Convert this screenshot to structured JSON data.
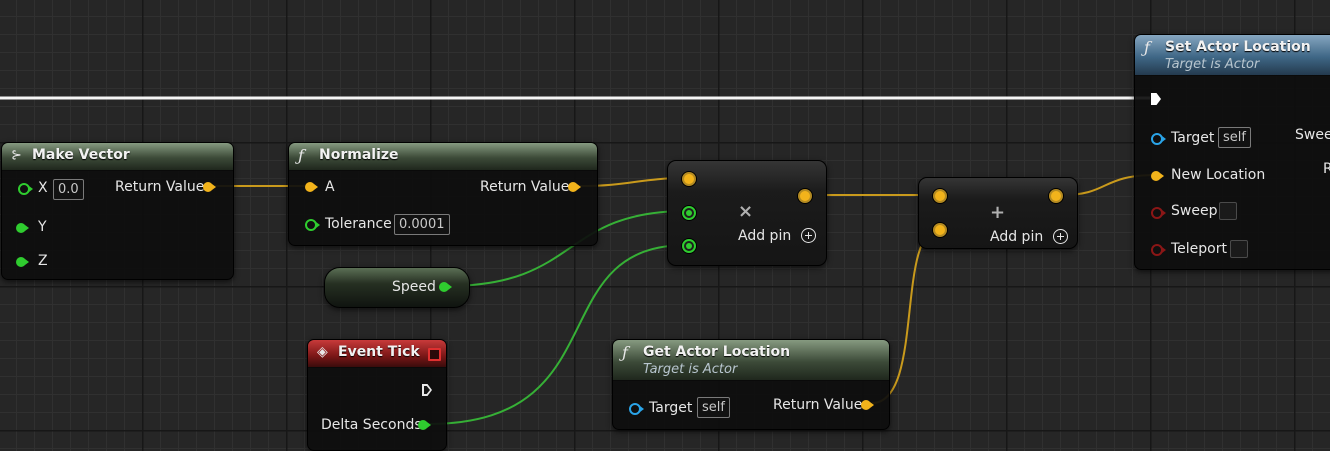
{
  "colors": {
    "float_pin": "#f2b31b",
    "vector_pin": "#f2b31b",
    "float_green_pin": "#2fcc2f",
    "object_pin": "#2aa4e8",
    "bool_pin": "#8a1616",
    "exec_wire": "#ffffff",
    "pure_function_header": "#3c4a38",
    "event_header": "#7a1616",
    "impure_function_header": "#3f6786"
  },
  "nodes": {
    "make_vector": {
      "icon": "make-struct-icon",
      "title": "Make Vector",
      "x_label": "X",
      "x_value": "0.0",
      "y_label": "Y",
      "z_label": "Z",
      "return_label": "Return Value"
    },
    "normalize": {
      "icon": "function-icon",
      "title": "Normalize",
      "a_label": "A",
      "tolerance_label": "Tolerance",
      "tolerance_value": "0.0001",
      "return_label": "Return Value"
    },
    "speed": {
      "label": "Speed"
    },
    "multiply": {
      "symbol": "×",
      "add_pin_label": "Add pin"
    },
    "add": {
      "symbol": "+",
      "add_pin_label": "Add pin"
    },
    "event_tick": {
      "icon": "event-icon",
      "title": "Event Tick",
      "delta_label": "Delta Seconds"
    },
    "get_actor_location": {
      "icon": "function-icon",
      "title": "Get Actor Location",
      "subtitle": "Target is Actor",
      "target_label": "Target",
      "target_value": "self",
      "return_label": "Return Value"
    },
    "set_actor_location": {
      "icon": "function-icon",
      "title": "Set Actor Location",
      "subtitle": "Target is Actor",
      "target_label": "Target",
      "target_value": "self",
      "new_location_label": "New Location",
      "sweep_label": "Sweep",
      "teleport_label": "Teleport",
      "right_sweep_partial": "Swee",
      "right_r_partial": "R"
    }
  },
  "glyphs": {
    "function": "ƒ"
  }
}
